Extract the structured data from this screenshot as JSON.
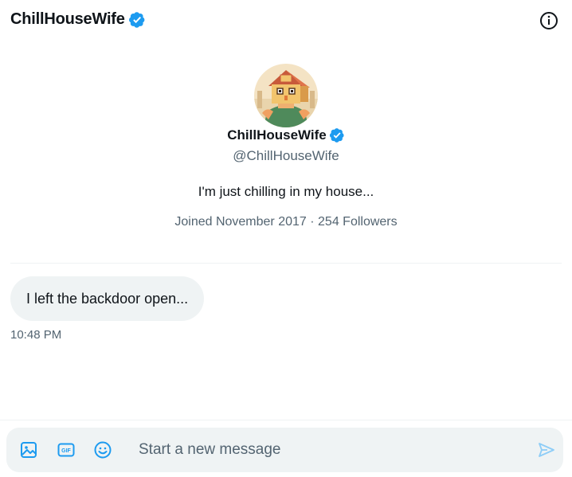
{
  "header": {
    "title": "ChillHouseWife"
  },
  "icons": {
    "verified": "verified-badge-icon",
    "info": "info-icon",
    "media": "image-icon",
    "gif": "gif-icon",
    "emoji": "emoji-icon",
    "send": "send-icon"
  },
  "colors": {
    "accent": "#1d9bf0",
    "text": "#0f1419",
    "secondary": "#536471",
    "bubble": "#eff3f4"
  },
  "profile": {
    "name": "ChillHouseWife",
    "handle": "@ChillHouseWife",
    "bio": "I'm just chilling in my house...",
    "joined": "Joined November 2017",
    "separator": "·",
    "followers": "254 Followers"
  },
  "messages": [
    {
      "text": "I left the backdoor open...",
      "time": "10:48 PM"
    }
  ],
  "composer": {
    "gif_label": "GIF",
    "placeholder": "Start a new message"
  }
}
